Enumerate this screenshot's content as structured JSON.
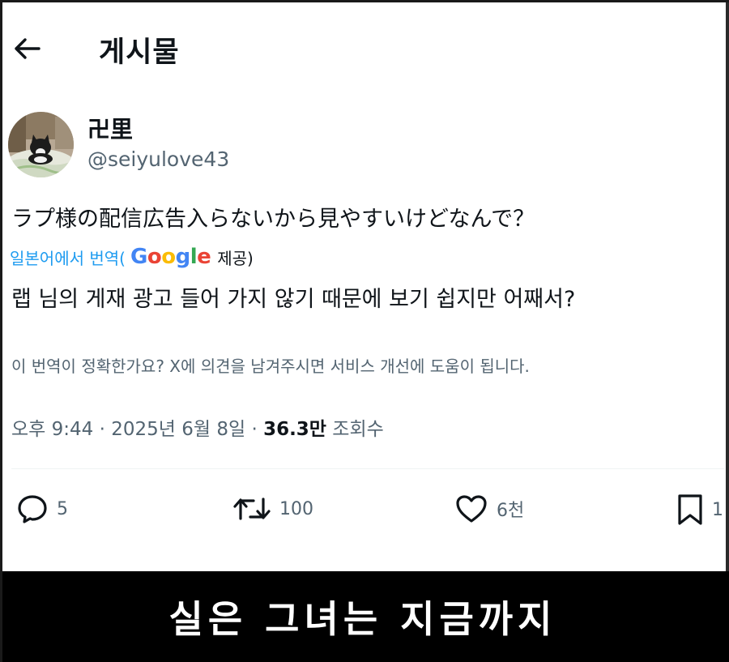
{
  "header": {
    "title": "게시물",
    "back_icon": "arrow-left-icon"
  },
  "author": {
    "display_name": "卍里",
    "handle": "@seiyulove43",
    "avatar": "cat-avatar"
  },
  "post": {
    "text": "ラプ様の配信広告入らないから見やすいけどなんで？",
    "translation_source": "일본어에서 번역(",
    "translation_provider": "Google",
    "translation_provided": "제공)",
    "translated_text": "랩 님의 게재 광고 들어 가지 않기 때문에 보기 쉽지만 어째서?",
    "translation_feedback": "이 번역이 정확한가요? X에 의견을 남겨주시면 서비스 개선에 도움이 됩니다."
  },
  "meta": {
    "time": "오후 9:44",
    "separator": "·",
    "date": "2025년 6월 8일",
    "views_count": "36.3만",
    "views_label": "조회수"
  },
  "actions": {
    "reply_count": "5",
    "repost_count": "100",
    "like_count": "6천",
    "bookmark_count": "1"
  },
  "subtitle": "실은 그녀는 지금까지",
  "colors": {
    "text": "#0f1419",
    "secondary": "#536471",
    "link": "#1d9bf0",
    "subtitle_bg": "#000000",
    "subtitle_text": "#ffffff"
  }
}
